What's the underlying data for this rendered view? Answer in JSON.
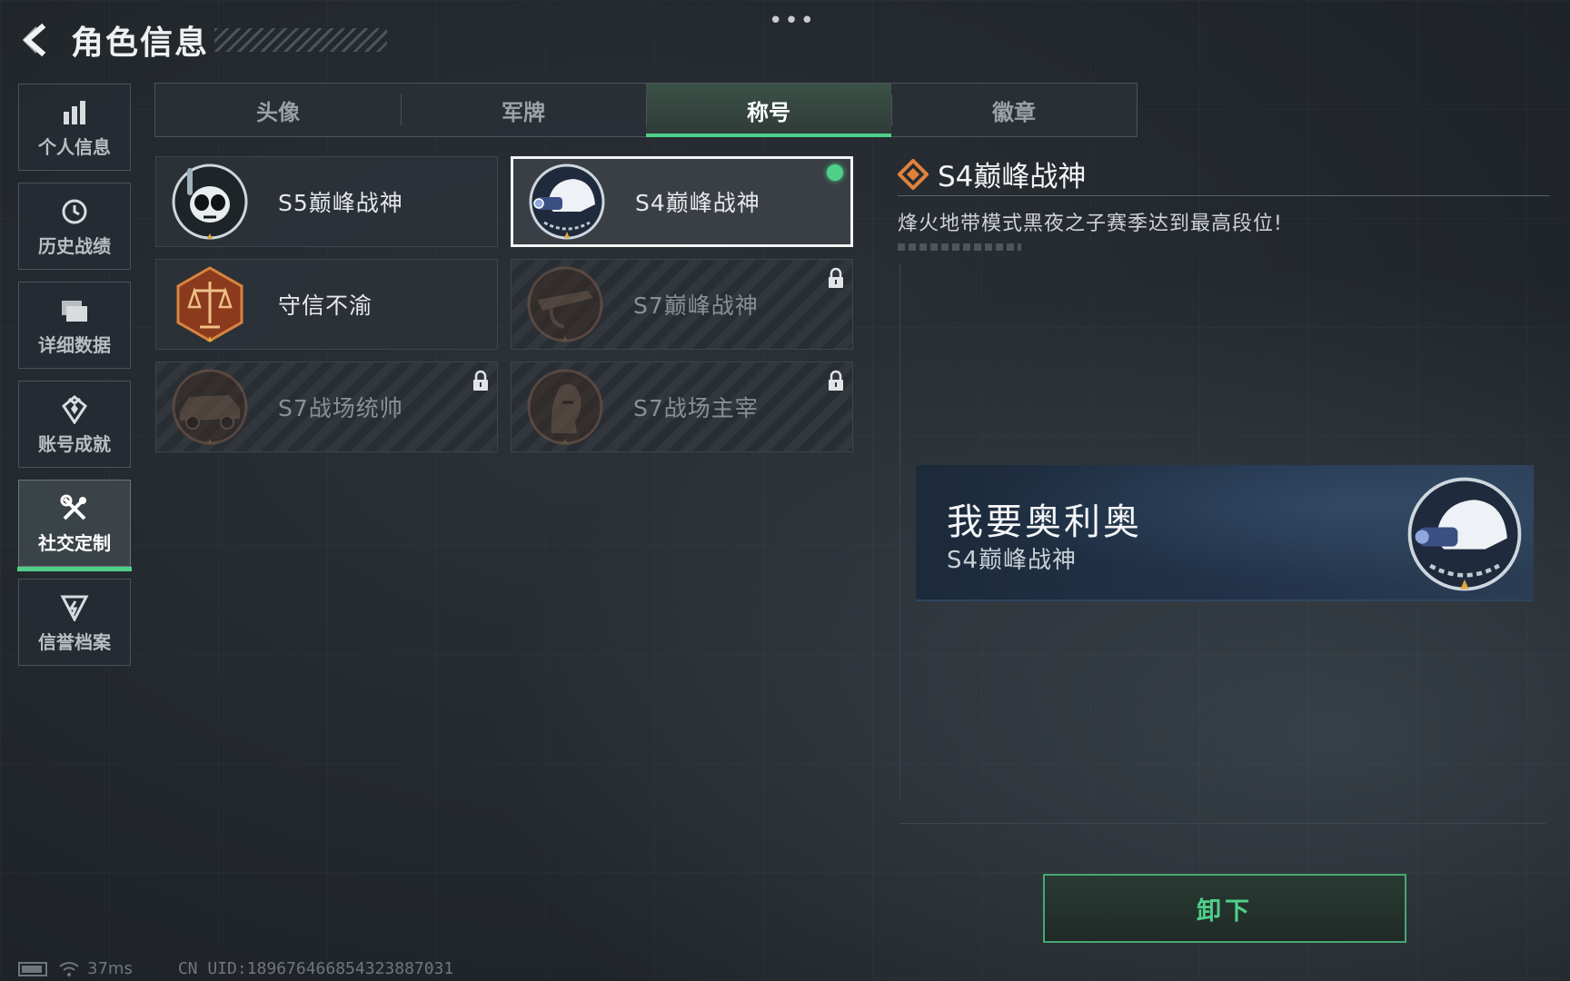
{
  "header": {
    "title": "角色信息"
  },
  "sidebar": {
    "items": [
      {
        "label": "个人信息",
        "icon": "bar-chart-icon"
      },
      {
        "label": "历史战绩",
        "icon": "clock-icon"
      },
      {
        "label": "详细数据",
        "icon": "folder-icon"
      },
      {
        "label": "账号成就",
        "icon": "achievement-icon"
      },
      {
        "label": "社交定制",
        "icon": "tools-icon",
        "active": true
      },
      {
        "label": "信誉档案",
        "icon": "reputation-icon"
      }
    ]
  },
  "tabs": [
    {
      "label": "头像"
    },
    {
      "label": "军牌"
    },
    {
      "label": "称号",
      "active": true
    },
    {
      "label": "徽章"
    }
  ],
  "titles": [
    {
      "label": "S5巅峰战神",
      "badge": "diver-skull-badge-icon",
      "locked": false
    },
    {
      "label": "S4巅峰战神",
      "badge": "night-vision-helmet-badge-icon",
      "locked": false,
      "selected": true,
      "equipped": true
    },
    {
      "label": "守信不渝",
      "badge": "scales-badge-icon",
      "locked": false
    },
    {
      "label": "S7巅峰战神",
      "badge": "rifle-badge-icon",
      "locked": true
    },
    {
      "label": "S7战场统帅",
      "badge": "vehicle-badge-icon",
      "locked": true
    },
    {
      "label": "S7战场主宰",
      "badge": "soldier-badge-icon",
      "locked": true
    }
  ],
  "detail": {
    "title": "S4巅峰战神",
    "description": "烽火地带模式黑夜之子赛季达到最高段位!"
  },
  "preview": {
    "player_name": "我要奥利奥",
    "title": "S4巅峰战神"
  },
  "actions": {
    "unequip_label": "卸下"
  },
  "status": {
    "ping": "37ms",
    "uid": "CN UID:1896764668543238870​31"
  },
  "colors": {
    "accent": "#4fd08a",
    "detail_icon": "#e0823c"
  }
}
